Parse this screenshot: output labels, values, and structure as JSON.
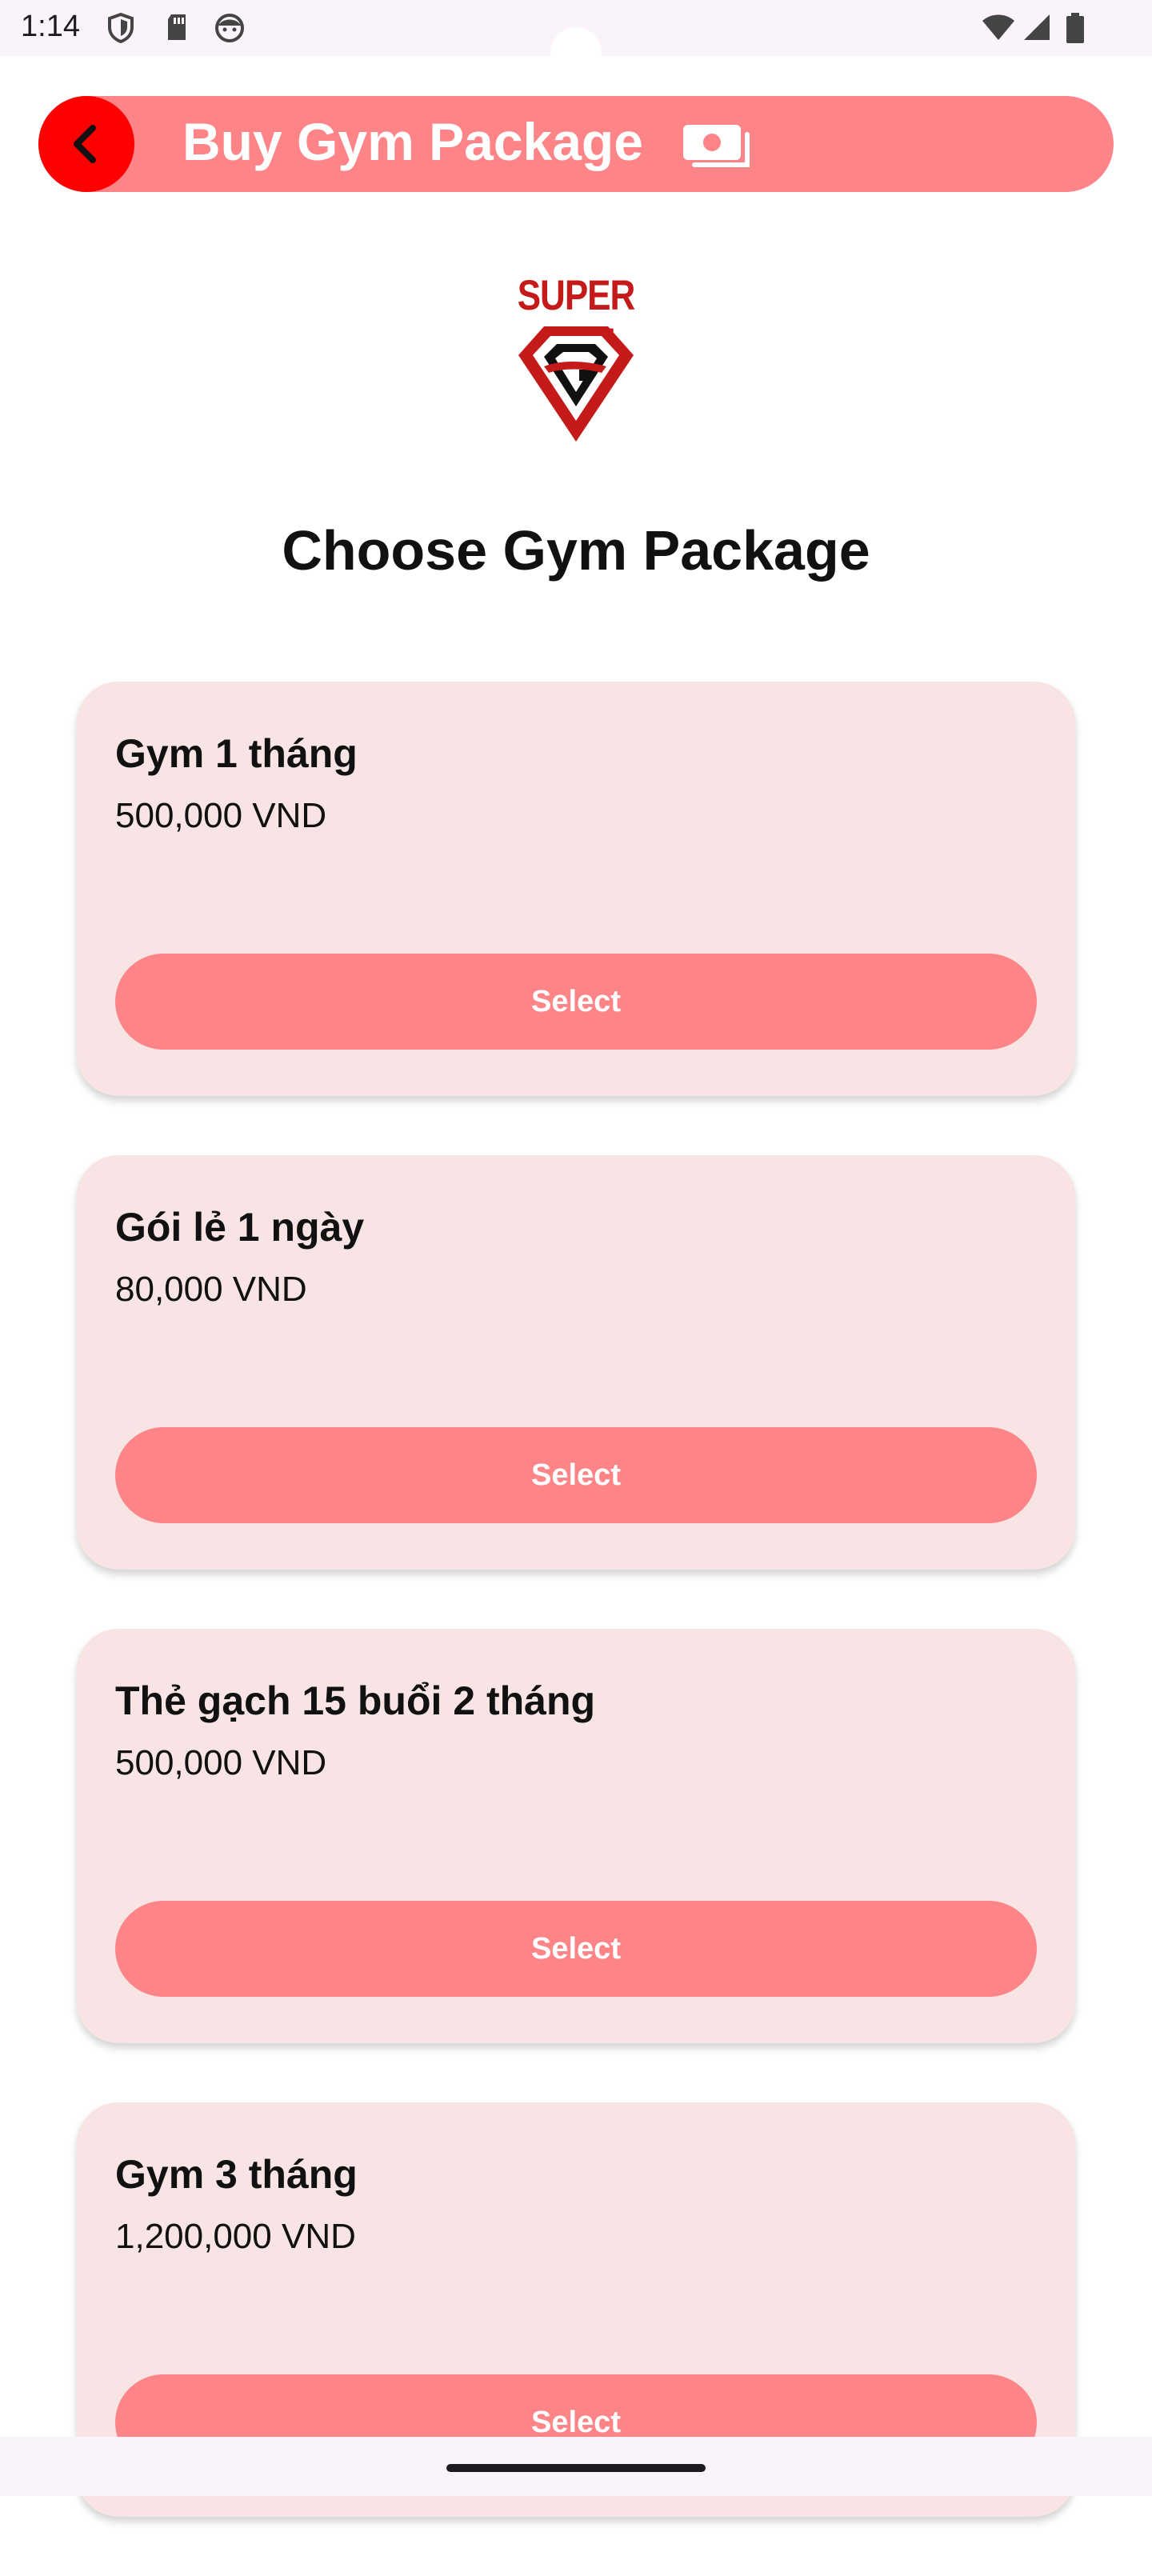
{
  "status_bar": {
    "time": "1:14",
    "left_icons": [
      "shield-icon",
      "sd-card-icon",
      "face-icon"
    ],
    "right_icons": [
      "wifi-icon",
      "signal-icon",
      "battery-icon"
    ]
  },
  "header": {
    "title": "Buy Gym Package",
    "back_icon": "chevron-left-icon",
    "title_icon": "money-icon",
    "colors": {
      "bar": "#ff8488",
      "back_button": "#ff0000"
    }
  },
  "logo": {
    "text": "SUPER GYM"
  },
  "page_title": "Choose Gym Package",
  "packages": [
    {
      "name": "Gym 1 tháng",
      "price": "500,000 VND",
      "button_label": "Select"
    },
    {
      "name": "Gói lẻ 1 ngày",
      "price": "80,000 VND",
      "button_label": "Select"
    },
    {
      "name": "Thẻ gạch 15 buổi 2 tháng",
      "price": "500,000 VND",
      "button_label": "Select"
    },
    {
      "name": "Gym 3 tháng",
      "price": "1,200,000 VND",
      "button_label": "Select"
    }
  ],
  "colors": {
    "card_bg": "#f8e4e4",
    "button": "#ff8488"
  }
}
